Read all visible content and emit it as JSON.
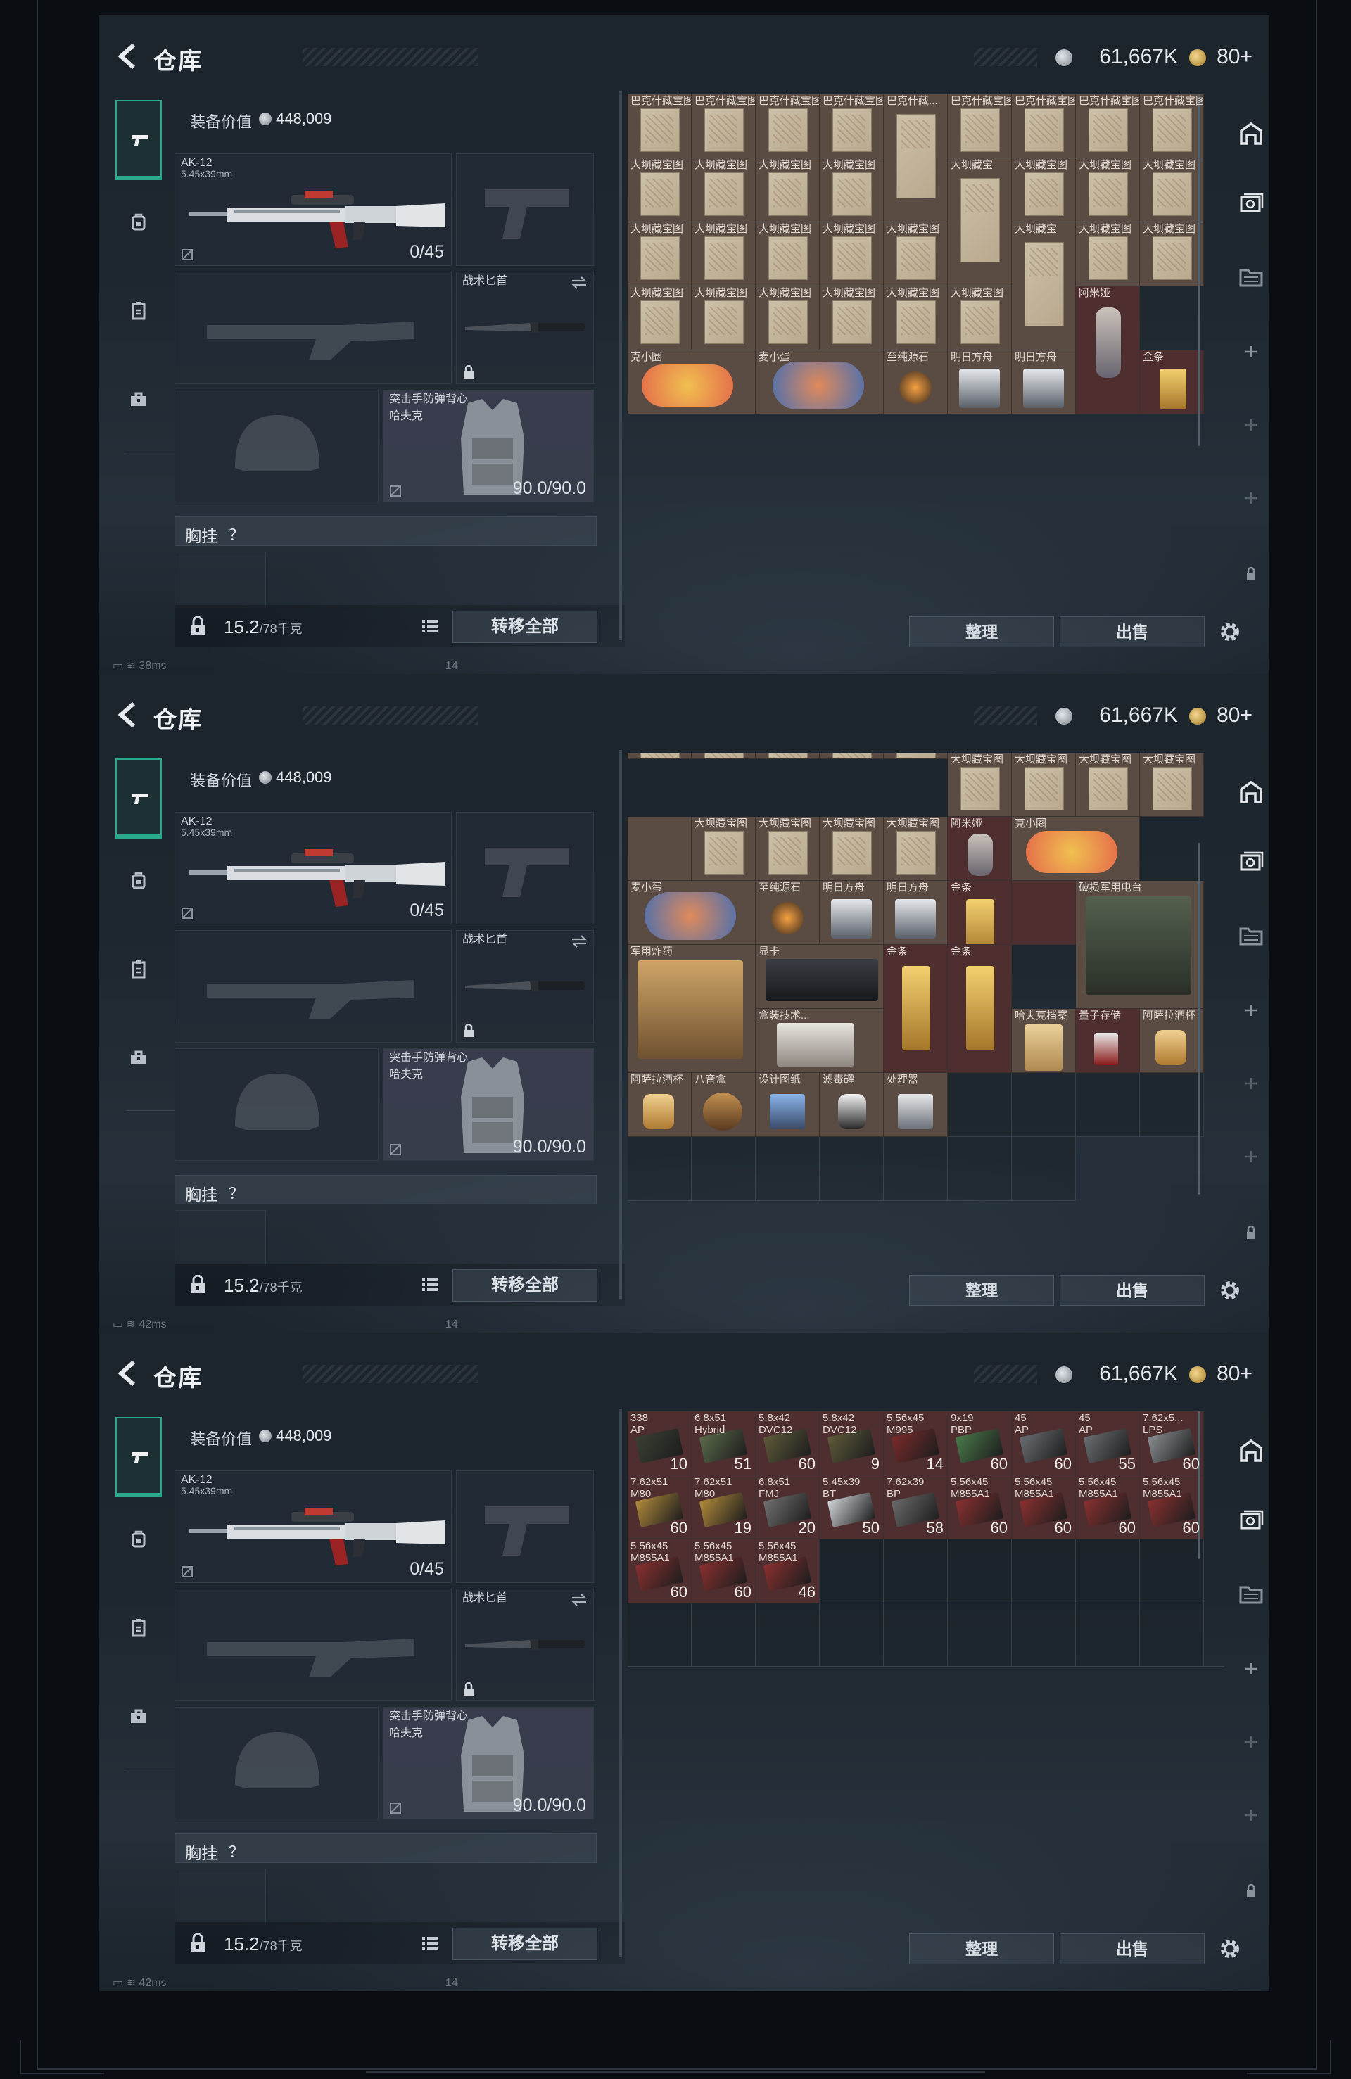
{
  "panels": [
    {
      "title": "仓库",
      "currency": {
        "silver": "61,667K",
        "gold": "80+"
      },
      "equip": {
        "value_label": "装备价值",
        "value": "448,009",
        "primary_weapon": {
          "name": "AK-12",
          "caliber": "5.45x39mm",
          "ammo": "0/45"
        },
        "melee": {
          "name": "战术匕首"
        },
        "vest": {
          "name": "突击手防弹背心",
          "brand": "哈夫克",
          "durability": "90.0/90.0"
        },
        "chest_rig": "胸挂",
        "chest_q": "？",
        "weight": "15.2",
        "weight_max": "/78千克",
        "transfer_label": "转移全部"
      },
      "inventory_items": [
        {
          "name": "巴克什藏宝图"
        },
        {
          "name": "巴克什藏宝图"
        },
        {
          "name": "巴克什藏宝图"
        },
        {
          "name": "巴克什藏宝图"
        },
        {
          "name": "巴克什藏..."
        },
        {
          "name": "巴克什藏宝图"
        },
        {
          "name": "巴克什藏宝图"
        },
        {
          "name": "巴克什藏宝图"
        },
        {
          "name": "巴克什藏宝图"
        },
        {
          "name": "大坝藏宝图"
        },
        {
          "name": "大坝藏宝图"
        },
        {
          "name": "大坝藏宝图"
        },
        {
          "name": "大坝藏宝图"
        },
        {
          "name": "大坝藏宝"
        },
        {
          "name": "大坝藏宝图"
        },
        {
          "name": "大坝藏宝图"
        },
        {
          "name": "大坝藏宝图"
        },
        {
          "name": "大坝藏宝图"
        },
        {
          "name": "大坝藏宝图"
        },
        {
          "name": "大坝藏宝图"
        },
        {
          "name": "大坝藏宝图"
        },
        {
          "name": "大坝藏宝图"
        },
        {
          "name": "大坝藏宝"
        },
        {
          "name": "大坝藏宝图"
        },
        {
          "name": "大坝藏宝图"
        },
        {
          "name": "大坝藏宝图"
        },
        {
          "name": "大坝藏宝图"
        },
        {
          "name": "大坝藏宝图"
        },
        {
          "name": "大坝藏宝图"
        },
        {
          "name": "大坝藏宝图"
        },
        {
          "name": "大坝藏宝图"
        },
        {
          "name": "阿米娅"
        },
        {
          "name": "克小圈"
        },
        {
          "name": "麦小蛋"
        },
        {
          "name": "至纯源石"
        },
        {
          "name": "明日方舟"
        },
        {
          "name": "明日方舟"
        },
        {
          "name": "金条"
        }
      ],
      "status": {
        "ping": "38ms",
        "num": "14"
      },
      "sort_label": "整理",
      "sell_label": "出售"
    },
    {
      "title": "仓库",
      "currency": {
        "silver": "61,667K",
        "gold": "80+"
      },
      "equip": {
        "value_label": "装备价值",
        "value": "448,009",
        "primary_weapon": {
          "name": "AK-12",
          "caliber": "5.45x39mm",
          "ammo": "0/45"
        },
        "melee": {
          "name": "战术匕首"
        },
        "vest": {
          "name": "突击手防弹背心",
          "brand": "哈夫克",
          "durability": "90.0/90.0"
        },
        "chest_rig": "胸挂",
        "chest_q": "？",
        "weight": "15.2",
        "weight_max": "/78千克",
        "transfer_label": "转移全部"
      },
      "inventory_items": [
        {
          "name": "大坝藏宝图"
        },
        {
          "name": "大坝藏宝图"
        },
        {
          "name": "大坝藏宝图"
        },
        {
          "name": "大坝藏宝图"
        },
        {
          "name": "大坝藏宝图"
        },
        {
          "name": "大坝藏宝图"
        },
        {
          "name": "大坝藏宝图"
        },
        {
          "name": "大坝藏宝图"
        },
        {
          "name": "阿米娅"
        },
        {
          "name": "克小圈"
        },
        {
          "name": "麦小蛋"
        },
        {
          "name": "至纯源石"
        },
        {
          "name": "明日方舟"
        },
        {
          "name": "明日方舟"
        },
        {
          "name": "金条"
        },
        {
          "name": "破损军用电台"
        },
        {
          "name": "军用炸药"
        },
        {
          "name": "显卡"
        },
        {
          "name": "金条"
        },
        {
          "name": "金条"
        },
        {
          "name": "盒装技术..."
        },
        {
          "name": "哈夫克档案"
        },
        {
          "name": "量子存储"
        },
        {
          "name": "阿萨拉酒杯"
        },
        {
          "name": "阿萨拉酒杯"
        },
        {
          "name": "八音盒"
        },
        {
          "name": "设计图纸"
        },
        {
          "name": "滤毒罐"
        },
        {
          "name": "处理器"
        }
      ],
      "status": {
        "ping": "42ms",
        "num": "14"
      },
      "sort_label": "整理",
      "sell_label": "出售"
    },
    {
      "title": "仓库",
      "currency": {
        "silver": "61,667K",
        "gold": "80+"
      },
      "equip": {
        "value_label": "装备价值",
        "value": "448,009",
        "primary_weapon": {
          "name": "AK-12",
          "caliber": "5.45x39mm",
          "ammo": "0/45"
        },
        "melee": {
          "name": "战术匕首"
        },
        "vest": {
          "name": "突击手防弹背心",
          "brand": "哈夫克",
          "durability": "90.0/90.0"
        },
        "chest_rig": "胸挂",
        "chest_q": "？",
        "weight": "15.2",
        "weight_max": "/78千克",
        "transfer_label": "转移全部"
      },
      "inventory_items": [
        {
          "name": "338",
          "sub": "AP",
          "count": "10"
        },
        {
          "name": "6.8x51",
          "sub": "Hybrid",
          "count": "51"
        },
        {
          "name": "5.8x42",
          "sub": "DVC12",
          "count": "60"
        },
        {
          "name": "5.8x42",
          "sub": "DVC12",
          "count": "9"
        },
        {
          "name": "5.56x45",
          "sub": "M995",
          "count": "14"
        },
        {
          "name": "9x19",
          "sub": "PBP",
          "count": "60"
        },
        {
          "name": "45",
          "sub": "AP",
          "count": "60"
        },
        {
          "name": "45",
          "sub": "AP",
          "count": "55"
        },
        {
          "name": "7.62x5...",
          "sub": "LPS",
          "count": "60"
        },
        {
          "name": "7.62x51",
          "sub": "M80",
          "count": "60"
        },
        {
          "name": "7.62x51",
          "sub": "M80",
          "count": "19"
        },
        {
          "name": "6.8x51",
          "sub": "FMJ",
          "count": "20"
        },
        {
          "name": "5.45x39",
          "sub": "BT",
          "count": "50"
        },
        {
          "name": "7.62x39",
          "sub": "BP",
          "count": "58"
        },
        {
          "name": "5.56x45",
          "sub": "M855A1",
          "count": "60"
        },
        {
          "name": "5.56x45",
          "sub": "M855A1",
          "count": "60"
        },
        {
          "name": "5.56x45",
          "sub": "M855A1",
          "count": "60"
        },
        {
          "name": "5.56x45",
          "sub": "M855A1",
          "count": "60"
        },
        {
          "name": "5.56x45",
          "sub": "M855A1",
          "count": "60"
        },
        {
          "name": "5.56x45",
          "sub": "M855A1",
          "count": "60"
        },
        {
          "name": "5.56x45",
          "sub": "M855A1",
          "count": "46"
        }
      ],
      "status": {
        "ping": "42ms",
        "num": "14"
      },
      "sort_label": "整理",
      "sell_label": "出售"
    }
  ],
  "colors": {
    "accent": "#2aa98d",
    "map_cell": "#5a4b43",
    "red_cell": "#4e2e2f",
    "gold": "#c9a24a"
  },
  "icons": [
    "back-arrow-icon",
    "silver-coin-icon",
    "gold-coin-icon",
    "pistol-icon",
    "backpack-icon",
    "clipboard-icon",
    "toolbox-icon",
    "lock-icon",
    "list-icon",
    "swap-icon",
    "gear-icon",
    "plus-icon",
    "storage-icon"
  ]
}
